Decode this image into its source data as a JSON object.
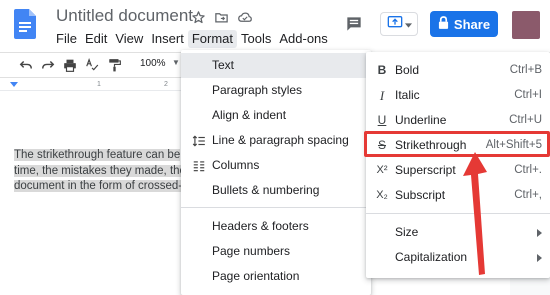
{
  "header": {
    "doc_title": "Untitled document",
    "menu": [
      "File",
      "Edit",
      "View",
      "Insert",
      "Format",
      "Tools",
      "Add-ons"
    ],
    "open_menu": "Format",
    "share_label": "Share",
    "accent_color": "#1a73e8"
  },
  "toolbar": {
    "zoom": "100%"
  },
  "ruler": {
    "ticks": [
      "1",
      "2"
    ]
  },
  "document": {
    "lines": [
      "The strikethrough feature can be",
      "time, the mistakes they made, the",
      "document in the form of crossed-o"
    ]
  },
  "format_menu": {
    "items": [
      {
        "label": "Text",
        "icon": "",
        "highlighted": true
      },
      {
        "label": "Paragraph styles",
        "icon": ""
      },
      {
        "label": "Align & indent",
        "icon": ""
      },
      {
        "label": "Line & paragraph spacing",
        "icon": "line-spacing-icon"
      },
      {
        "label": "Columns",
        "icon": "columns-icon"
      },
      {
        "label": "Bullets & numbering",
        "icon": ""
      },
      {
        "label": "Headers & footers",
        "icon": ""
      },
      {
        "label": "Page numbers",
        "icon": ""
      },
      {
        "label": "Page orientation",
        "icon": ""
      }
    ]
  },
  "text_menu": {
    "items": [
      {
        "label": "Bold",
        "icon": "B",
        "shortcut": "Ctrl+B"
      },
      {
        "label": "Italic",
        "icon": "I",
        "shortcut": "Ctrl+I"
      },
      {
        "label": "Underline",
        "icon": "U",
        "shortcut": "Ctrl+U"
      },
      {
        "label": "Strikethrough",
        "icon": "S",
        "shortcut": "Alt+Shift+5"
      },
      {
        "label": "Superscript",
        "icon": "X²",
        "shortcut": "Ctrl+."
      },
      {
        "label": "Subscript",
        "icon": "X₂",
        "shortcut": "Ctrl+,"
      },
      {
        "label": "Size",
        "icon": ""
      },
      {
        "label": "Capitalization",
        "icon": ""
      }
    ]
  },
  "annotation_color": "#e53935"
}
